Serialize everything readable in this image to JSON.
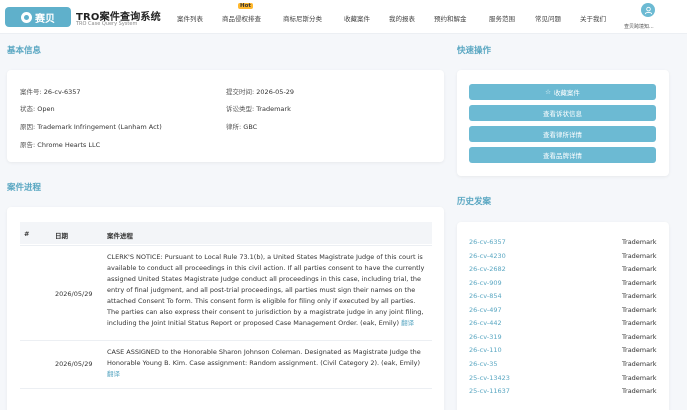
{
  "header": {
    "logo_text": "赛贝",
    "brand_title": "TRO案件查询系统",
    "brand_subtitle": "TRO Case Query System",
    "nav": [
      "案件列表",
      "商品侵权排查",
      "商标尼斯分类",
      "收藏案件",
      "我的报表",
      "预约和解金",
      "服务范围",
      "常见问题",
      "关于我们"
    ],
    "hot_badge": "Hot",
    "user_name": "查贝跨境知..."
  },
  "basic_info": {
    "title": "基本信息",
    "case_no_label": "案件号:",
    "case_no": "26-cv-6357",
    "submit_label": "提交时间:",
    "submit_date": "2026-05-29",
    "status_label": "状态:",
    "status": "Open",
    "type_label": "诉讼类型:",
    "type": "Trademark",
    "cause_label": "原因:",
    "cause": "Trademark Infringement (Lanham Act)",
    "firm_label": "律所:",
    "firm": "GBC",
    "plaintiff_label": "原告:",
    "plaintiff": "Chrome Hearts LLC"
  },
  "quick_actions": {
    "title": "快速操作",
    "buttons": [
      "收藏案件",
      "查看诉状信息",
      "查看律所详情",
      "查看品牌详情"
    ]
  },
  "progress": {
    "title": "案件进程",
    "columns": [
      "#",
      "日期",
      "案件进程"
    ],
    "rows": [
      {
        "date": "2026/05/29",
        "text": "CLERK'S NOTICE: Pursuant to Local Rule 73.1(b), a United States Magistrate Judge of this court is available to conduct all proceedings in this civil action. If all parties consent to have the currently assigned United States Magistrate Judge conduct all proceedings in this case, including trial, the entry of final judgment, and all post-trial proceedings, all parties must sign their names on the attached Consent To form. This consent form is eligible for filing only if executed by all parties. The parties can also express their consent to jurisdiction by a magistrate judge in any joint filing, including the Joint Initial Status Report or proposed Case Management Order. (eak, Emily)",
        "translate": "翻译"
      },
      {
        "date": "2026/05/29",
        "text": "CASE ASSIGNED to the Honorable Sharon Johnson Coleman. Designated as Magistrate Judge the Honorable Young B. Kim. Case assignment: Random assignment. (Civil Category 2). (eak, Emily)",
        "translate": "翻译"
      }
    ]
  },
  "history": {
    "title": "历史发案",
    "items": [
      {
        "id": "26-cv-6357",
        "type": "Trademark"
      },
      {
        "id": "26-cv-4230",
        "type": "Trademark"
      },
      {
        "id": "26-cv-2682",
        "type": "Trademark"
      },
      {
        "id": "26-cv-909",
        "type": "Trademark"
      },
      {
        "id": "26-cv-854",
        "type": "Trademark"
      },
      {
        "id": "26-cv-497",
        "type": "Trademark"
      },
      {
        "id": "26-cv-442",
        "type": "Trademark"
      },
      {
        "id": "26-cv-319",
        "type": "Trademark"
      },
      {
        "id": "26-cv-110",
        "type": "Trademark"
      },
      {
        "id": "26-cv-35",
        "type": "Trademark"
      },
      {
        "id": "25-cv-13423",
        "type": "Trademark"
      },
      {
        "id": "25-cv-11637",
        "type": "Trademark"
      }
    ]
  }
}
